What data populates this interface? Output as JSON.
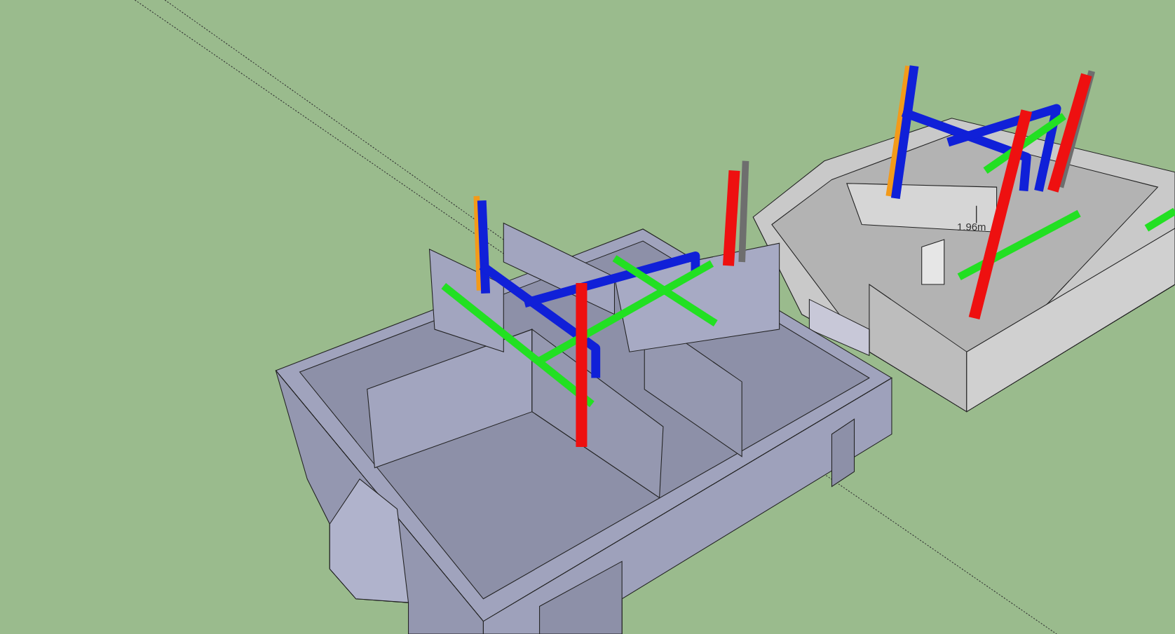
{
  "viewport": {
    "dimension_label": "1.96m"
  }
}
